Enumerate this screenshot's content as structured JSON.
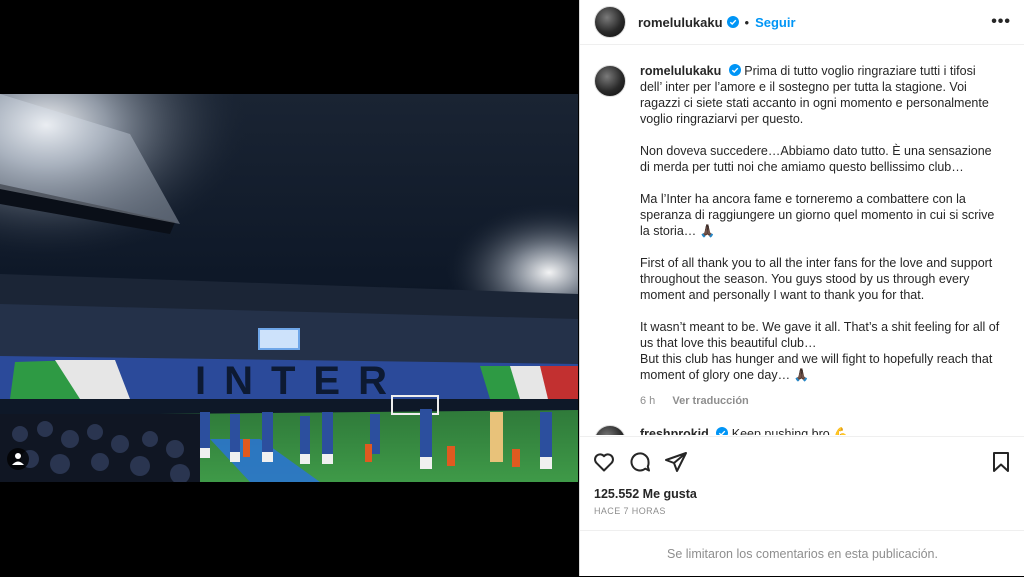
{
  "post": {
    "username": "romelulukaku",
    "separator": "•",
    "follow_label": "Seguir",
    "more_label": "•••"
  },
  "caption": {
    "username": "romelulukaku",
    "paragraphs": [
      "Prima di tutto voglio ringraziare tutti i tifosi dell’ inter per l’amore e il sostegno per tutta la stagione. Voi ragazzi ci siete stati accanto in ogni momento e personalmente voglio ringraziarvi per questo.",
      "Non doveva succedere…Abbiamo dato tutto. È una sensazione di merda per tutti noi che amiamo questo bellissimo club…",
      "Ma l’Inter ha ancora fame e torneremo a combattere con la speranza di raggiungere un giorno quel momento in cui si scrive la storia… 🙏🏿",
      "First of all thank you to all the inter fans for the love and support throughout the season. You guys stood by us through every moment and personally I want to thank you for that.",
      "It wasn’t meant to be. We gave it all. That’s a shit feeling for all of us that love this beautiful club…\nBut this club has hunger and we will fight to hopefully reach that moment of glory one day… 🙏🏿"
    ],
    "age": "6 h",
    "translate_label": "Ver traducción"
  },
  "next_comment": {
    "username": "freshprokid",
    "text": "Keep pushing bro 💪"
  },
  "likes": "125.552 Me gusta",
  "timestamp": "HACE 7 HORAS",
  "comments_limited": "Se limitaron los comentarios en esta publicación.",
  "colors": {
    "accent": "#0095f6",
    "verified": "#0095f6",
    "muted": "#8e8e8e"
  },
  "photo": {
    "banner_text": "INTER"
  }
}
